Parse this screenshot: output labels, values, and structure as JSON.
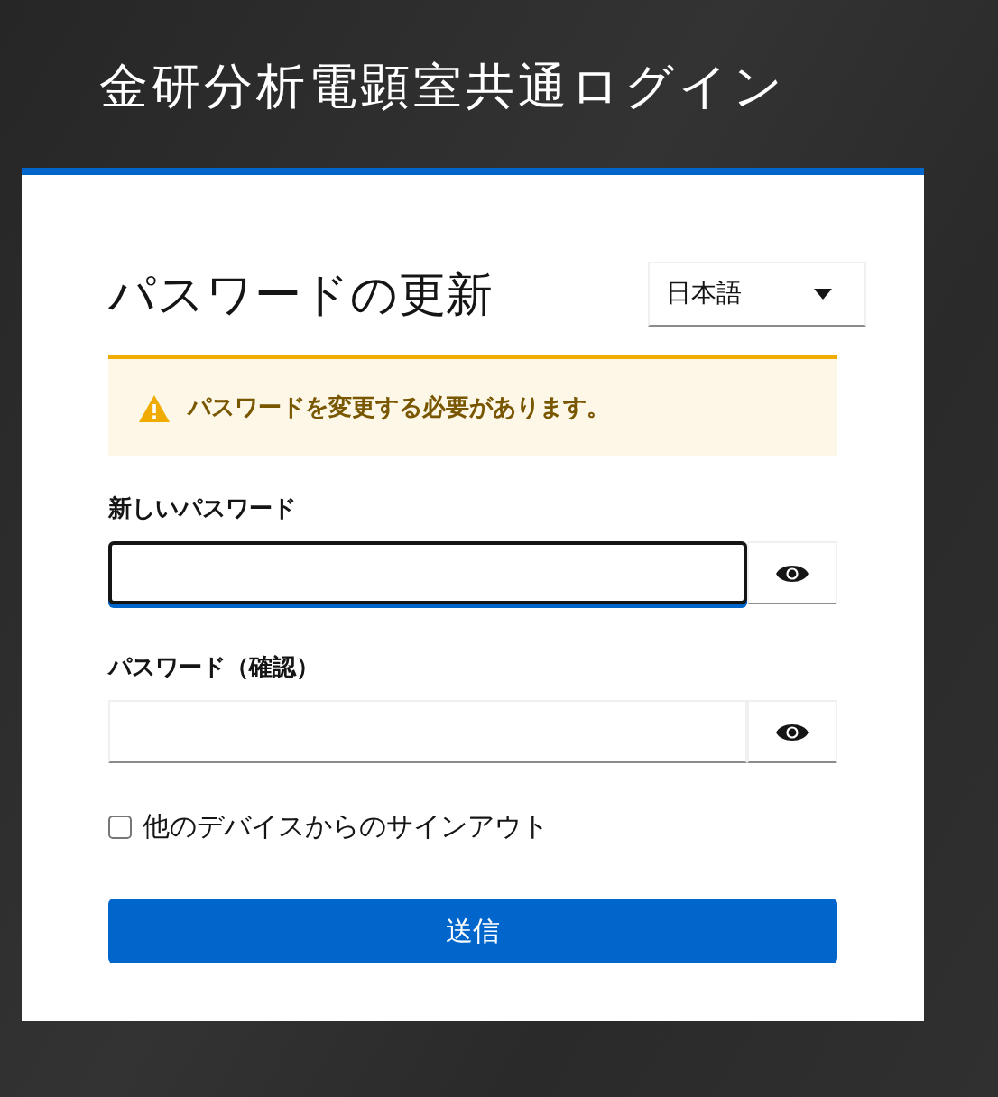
{
  "header": {
    "title": "金研分析電顕室共通ログイン"
  },
  "card": {
    "heading": "パスワードの更新",
    "language": {
      "value": "日本語"
    },
    "alert": {
      "kind": "warning",
      "message": "パスワードを変更する必要があります。"
    },
    "fields": [
      {
        "label": "新しいパスワード",
        "focused": true
      },
      {
        "label": "パスワード（確認）",
        "focused": false
      }
    ],
    "checkbox": {
      "label": "他のデバイスからのサインアウト",
      "checked": false
    },
    "submit": "送信"
  }
}
